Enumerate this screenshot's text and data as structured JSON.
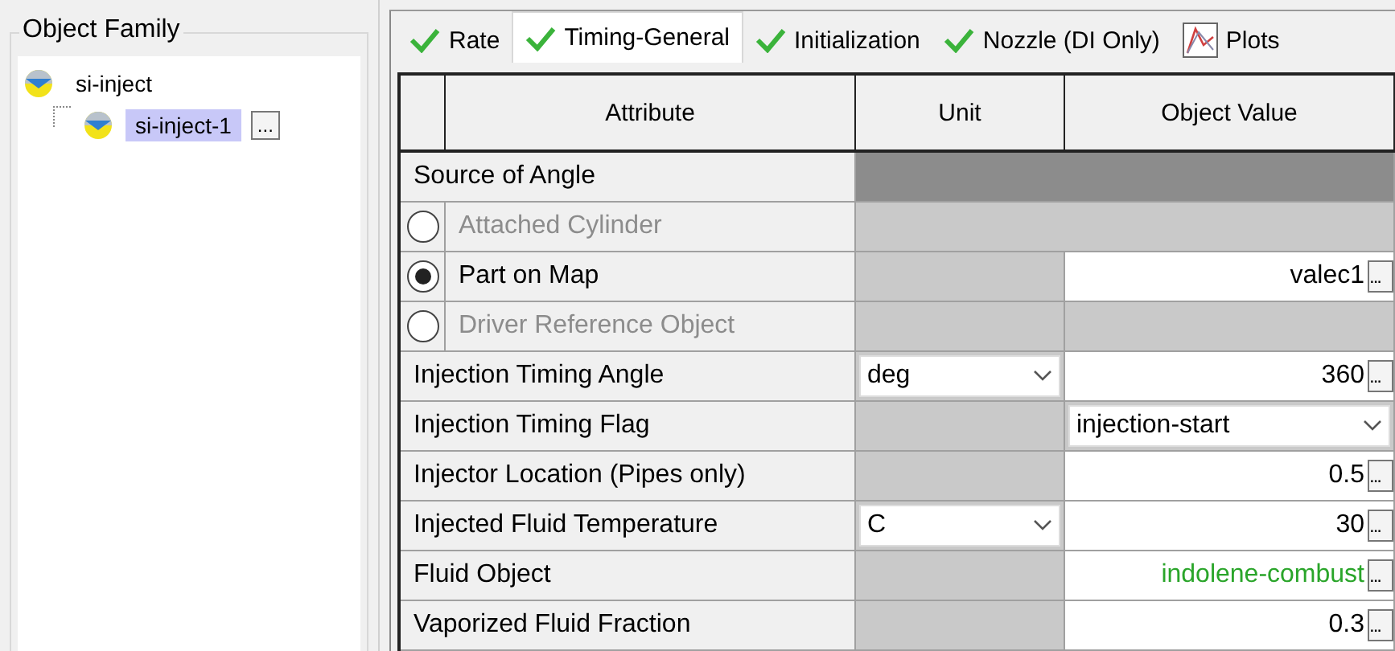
{
  "object_family": {
    "title": "Object Family",
    "tree": [
      {
        "label": "si-inject",
        "selected": false,
        "children": [
          {
            "label": "si-inject-1",
            "selected": true,
            "button": "..."
          }
        ]
      }
    ]
  },
  "tabs": [
    {
      "label": "Rate",
      "kind": "status",
      "selected": false
    },
    {
      "label": "Timing-General",
      "kind": "status",
      "selected": true
    },
    {
      "label": "Initialization",
      "kind": "status",
      "selected": false
    },
    {
      "label": "Nozzle (DI Only)",
      "kind": "status",
      "selected": false
    },
    {
      "label": "Plots",
      "kind": "plot",
      "selected": false
    }
  ],
  "table": {
    "columns": [
      "Attribute",
      "Unit",
      "Object Value"
    ],
    "rows": [
      {
        "kind": "section",
        "attribute": "Source of Angle"
      },
      {
        "kind": "radio",
        "attribute": "Attached Cylinder",
        "selected": false,
        "disabled": true,
        "unit": {
          "kind": "merged"
        },
        "value": {
          "kind": "merged"
        }
      },
      {
        "kind": "radio",
        "attribute": "Part on Map",
        "selected": true,
        "disabled": false,
        "unit": {
          "kind": "none"
        },
        "value": {
          "kind": "text",
          "text": "valec1",
          "button": "..."
        }
      },
      {
        "kind": "radio",
        "attribute": "Driver Reference Object",
        "selected": false,
        "disabled": true,
        "unit": {
          "kind": "none"
        },
        "value": {
          "kind": "none"
        }
      },
      {
        "kind": "field",
        "attribute": "Injection Timing Angle",
        "unit": {
          "kind": "dropdown",
          "text": "deg"
        },
        "value": {
          "kind": "text",
          "text": "360",
          "button": "..."
        }
      },
      {
        "kind": "field",
        "attribute": "Injection Timing Flag",
        "unit": {
          "kind": "none"
        },
        "value": {
          "kind": "dropdown",
          "text": "injection-start"
        }
      },
      {
        "kind": "field",
        "attribute": "Injector Location (Pipes only)",
        "unit": {
          "kind": "none"
        },
        "value": {
          "kind": "text",
          "text": "0.5",
          "button": "..."
        }
      },
      {
        "kind": "field",
        "attribute": "Injected Fluid Temperature",
        "unit": {
          "kind": "dropdown",
          "text": "C"
        },
        "value": {
          "kind": "text",
          "text": "30",
          "button": "..."
        }
      },
      {
        "kind": "field",
        "attribute": "Fluid Object",
        "unit": {
          "kind": "none"
        },
        "value": {
          "kind": "reference",
          "text": "indolene-combust",
          "button": "..."
        }
      },
      {
        "kind": "field",
        "attribute": "Vaporized Fluid Fraction",
        "unit": {
          "kind": "none"
        },
        "value": {
          "kind": "text",
          "text": "0.3",
          "button": "..."
        }
      }
    ]
  }
}
